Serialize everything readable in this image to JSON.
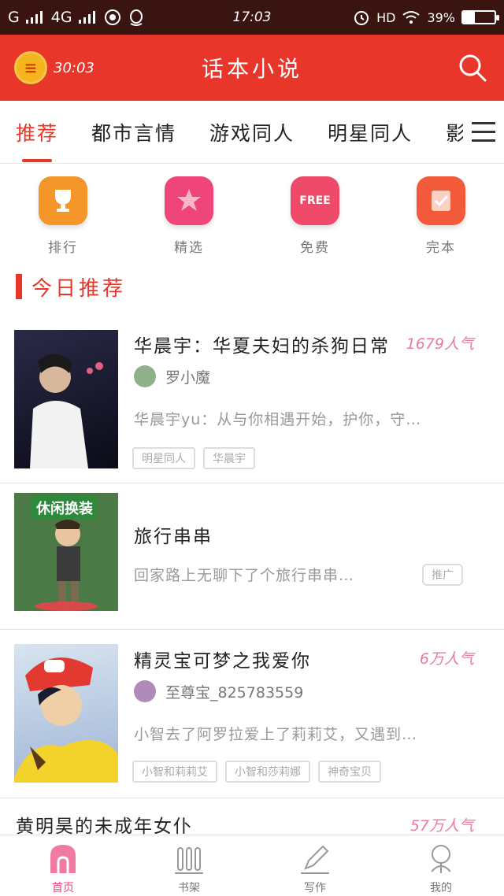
{
  "status_bar": {
    "carrier": "G",
    "network": "4G",
    "time": "17:03",
    "hd": "HD",
    "battery": "39%"
  },
  "app_bar": {
    "timer": "30:03",
    "title": "话本小说"
  },
  "tabs": [
    {
      "label": "推荐",
      "active": true
    },
    {
      "label": "都市言情"
    },
    {
      "label": "游戏同人"
    },
    {
      "label": "明星同人"
    },
    {
      "label": "影视"
    }
  ],
  "quick_entries": [
    {
      "label": "排行",
      "icon": "trophy-icon",
      "color": "#f5962a"
    },
    {
      "label": "精选",
      "icon": "star-icon",
      "color": "#f0457a"
    },
    {
      "label": "免费",
      "icon": "free-icon",
      "color": "#f04a6a",
      "badge": "FREE"
    },
    {
      "label": "完本",
      "icon": "check-book-icon",
      "color": "#f25a3a"
    }
  ],
  "section": {
    "title": "今日推荐"
  },
  "books": [
    {
      "title": "华晨宇：华夏夫妇的杀狗日常",
      "popularity": "1679人气",
      "author": "罗小魔",
      "desc": "华晨宇yu：从与你相遇开始，护你，守…",
      "tags": [
        "明星同人",
        "华晨宇"
      ]
    },
    {
      "title": "旅行串串",
      "desc": "回家路上无聊下了个旅行串串…",
      "promo": "推广",
      "cover_text": "休闲换装"
    },
    {
      "title": "精灵宝可梦之我爱你",
      "popularity": "6万人气",
      "author": "至尊宝_825783559",
      "desc": "小智去了阿罗拉爱上了莉莉艾，又遇到…",
      "tags": [
        "小智和莉莉艾",
        "小智和莎莉娜",
        "神奇宝贝"
      ]
    },
    {
      "title": "黄明昊的未成年女仆",
      "popularity": "57万人气"
    }
  ],
  "bottom_nav": [
    {
      "label": "首页",
      "icon": "home-icon",
      "active": true
    },
    {
      "label": "书架",
      "icon": "bookshelf-icon"
    },
    {
      "label": "写作",
      "icon": "pen-icon"
    },
    {
      "label": "我的",
      "icon": "profile-icon"
    }
  ],
  "colors": {
    "brand": "#e8362b",
    "accent_pink": "#e87aa3",
    "status_bar": "#3a1410"
  }
}
